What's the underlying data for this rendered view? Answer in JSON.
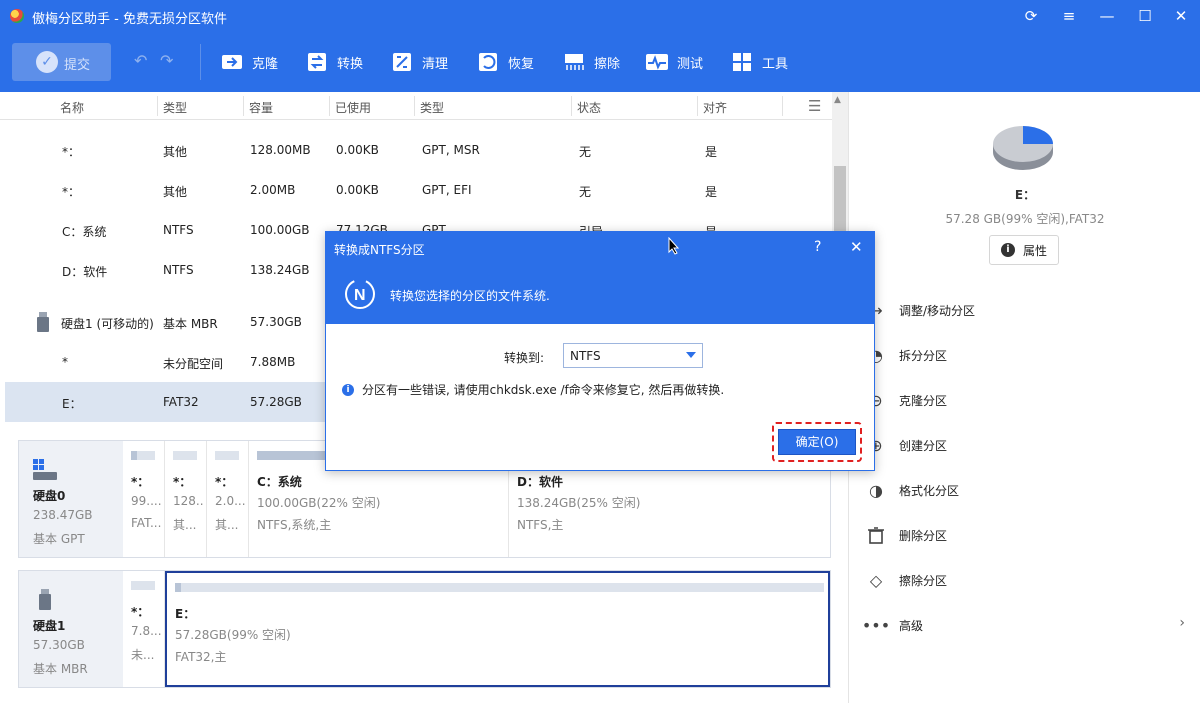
{
  "app": {
    "title": "傲梅分区助手 - 免费无损分区软件"
  },
  "toolbar": {
    "submit": "提交",
    "tools": [
      {
        "label": "克隆",
        "icon": "clone-icon"
      },
      {
        "label": "转换",
        "icon": "convert-icon"
      },
      {
        "label": "清理",
        "icon": "cleanup-icon"
      },
      {
        "label": "恢复",
        "icon": "recover-icon"
      },
      {
        "label": "擦除",
        "icon": "wipe-icon"
      },
      {
        "label": "测试",
        "icon": "test-icon"
      },
      {
        "label": "工具",
        "icon": "tools-icon"
      }
    ]
  },
  "table": {
    "headers": [
      "名称",
      "类型",
      "容量",
      "已使用",
      "类型",
      "状态",
      "对齐"
    ],
    "rows": [
      {
        "name": "*：",
        "type": "其他",
        "cap": "128.00MB",
        "used": "0.00KB",
        "fs": "GPT, MSR",
        "status": "无",
        "align": "是"
      },
      {
        "name": "*：",
        "type": "其他",
        "cap": "2.00MB",
        "used": "0.00KB",
        "fs": "GPT, EFI",
        "status": "无",
        "align": "是"
      },
      {
        "name": "C：系统",
        "type": "NTFS",
        "cap": "100.00GB",
        "used": "77.12GB",
        "fs": "GPT",
        "status": "引导",
        "align": "是"
      },
      {
        "name": "D：软件",
        "type": "NTFS",
        "cap": "138.24GB",
        "used": "",
        "fs": "",
        "status": "",
        "align": ""
      },
      {
        "name": "硬盘1 (可移动的)",
        "type": "基本 MBR",
        "cap": "57.30GB",
        "used": "",
        "fs": "",
        "status": "",
        "align": ""
      },
      {
        "name": "*",
        "type": "未分配空间",
        "cap": "7.88MB",
        "used": "",
        "fs": "",
        "status": "",
        "align": ""
      },
      {
        "name": "E：",
        "type": "FAT32",
        "cap": "57.28GB",
        "used": "",
        "fs": "",
        "status": "",
        "align": ""
      }
    ]
  },
  "disks": [
    {
      "name": "硬盘0",
      "size": "238.47GB",
      "style": "基本 GPT",
      "parts": [
        {
          "name": "*：",
          "size": "99....",
          "fs": "FAT...",
          "fill": 0.25
        },
        {
          "name": "*：",
          "size": "128...",
          "fs": "其...",
          "fill": 0
        },
        {
          "name": "*：",
          "size": "2.0...",
          "fs": "其...",
          "fill": 0
        },
        {
          "name": "C：系统",
          "size": "100.00GB(22% 空闲)",
          "fs": "NTFS,系统,主",
          "fill": 0.78
        },
        {
          "name": "D：软件",
          "size": "138.24GB(25% 空闲)",
          "fs": "NTFS,主",
          "fill": 0.75
        }
      ]
    },
    {
      "name": "硬盘1",
      "size": "57.30GB",
      "style": "基本 MBR",
      "parts": [
        {
          "name": "*：",
          "size": "7.8...",
          "fs": "未...",
          "fill": 0
        },
        {
          "name": "E：",
          "size": "57.28GB(99% 空闲)",
          "fs": "FAT32,主",
          "fill": 0.01
        }
      ]
    }
  ],
  "right": {
    "name": "E：",
    "info": "57.28 GB(99% 空闲),FAT32",
    "props": "属性",
    "ops": [
      {
        "label": "调整/移动分区",
        "icon": "resize-icon"
      },
      {
        "label": "拆分分区",
        "icon": "split-icon"
      },
      {
        "label": "克隆分区",
        "icon": "clone-partition-icon"
      },
      {
        "label": "创建分区",
        "icon": "create-partition-icon"
      },
      {
        "label": "格式化分区",
        "icon": "format-icon"
      },
      {
        "label": "删除分区",
        "icon": "delete-icon"
      },
      {
        "label": "擦除分区",
        "icon": "eraser-icon"
      },
      {
        "label": "高级",
        "icon": "more-icon"
      }
    ]
  },
  "dialog": {
    "title": "转换成NTFS分区",
    "help": "?",
    "banner": "转换您选择的分区的文件系统.",
    "convert_label": "转换到:",
    "convert_value": "NTFS",
    "warning": "分区有一些错误, 请使用chkdsk.exe /f命令来修复它, 然后再做转换.",
    "ok": "确定(O)"
  },
  "colors": {
    "accent": "#2b6fe8",
    "selected_row": "#dbe4f1",
    "highlight": "#e02020"
  }
}
